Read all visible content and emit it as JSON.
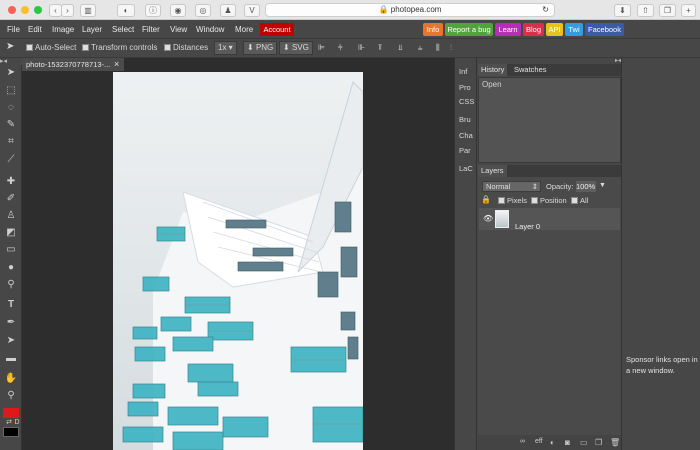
{
  "browser": {
    "url": "photopea.com"
  },
  "menubar": {
    "items": [
      "File",
      "Edit",
      "Image",
      "Layer",
      "Select",
      "Filter",
      "View",
      "Window",
      "More"
    ],
    "account": "Account",
    "badges": [
      {
        "label": "Info",
        "color": "#e8752a"
      },
      {
        "label": "Report a bug",
        "color": "#4fa43a"
      },
      {
        "label": "Learn",
        "color": "#b42fb4"
      },
      {
        "label": "Blog",
        "color": "#d8304a"
      },
      {
        "label": "API",
        "color": "#e7c21d"
      },
      {
        "label": "Twi",
        "color": "#2f9ee0"
      },
      {
        "label": "Facebook",
        "color": "#3b5ba3"
      }
    ]
  },
  "options": {
    "auto_select": "Auto-Select",
    "transform_controls": "Transform controls",
    "distances": "Distances",
    "zoom": "1x",
    "png": "PNG",
    "svg": "SVG"
  },
  "document": {
    "tab_title": "photo-1532370778713-...",
    "close": "×"
  },
  "side_tabs": [
    "Inf",
    "Pro",
    "CSS",
    "Bru",
    "Cha",
    "Par",
    "LaC"
  ],
  "history_panel": {
    "tabs": [
      "History",
      "Swatches"
    ],
    "items": [
      "Open"
    ]
  },
  "layers_panel": {
    "tab": "Layers",
    "blend_mode": "Normal",
    "opacity_label": "Opacity:",
    "opacity_value": "100%",
    "lock_pixels": "Pixels",
    "lock_position": "Position",
    "lock_all": "All",
    "layer_name": "Layer 0",
    "footer_link": "eff"
  },
  "sponsor": {
    "text": "Sponsor links open in a new window."
  },
  "colors": {
    "foreground": "#e01818",
    "background": "#000000",
    "account": "#c00000"
  }
}
